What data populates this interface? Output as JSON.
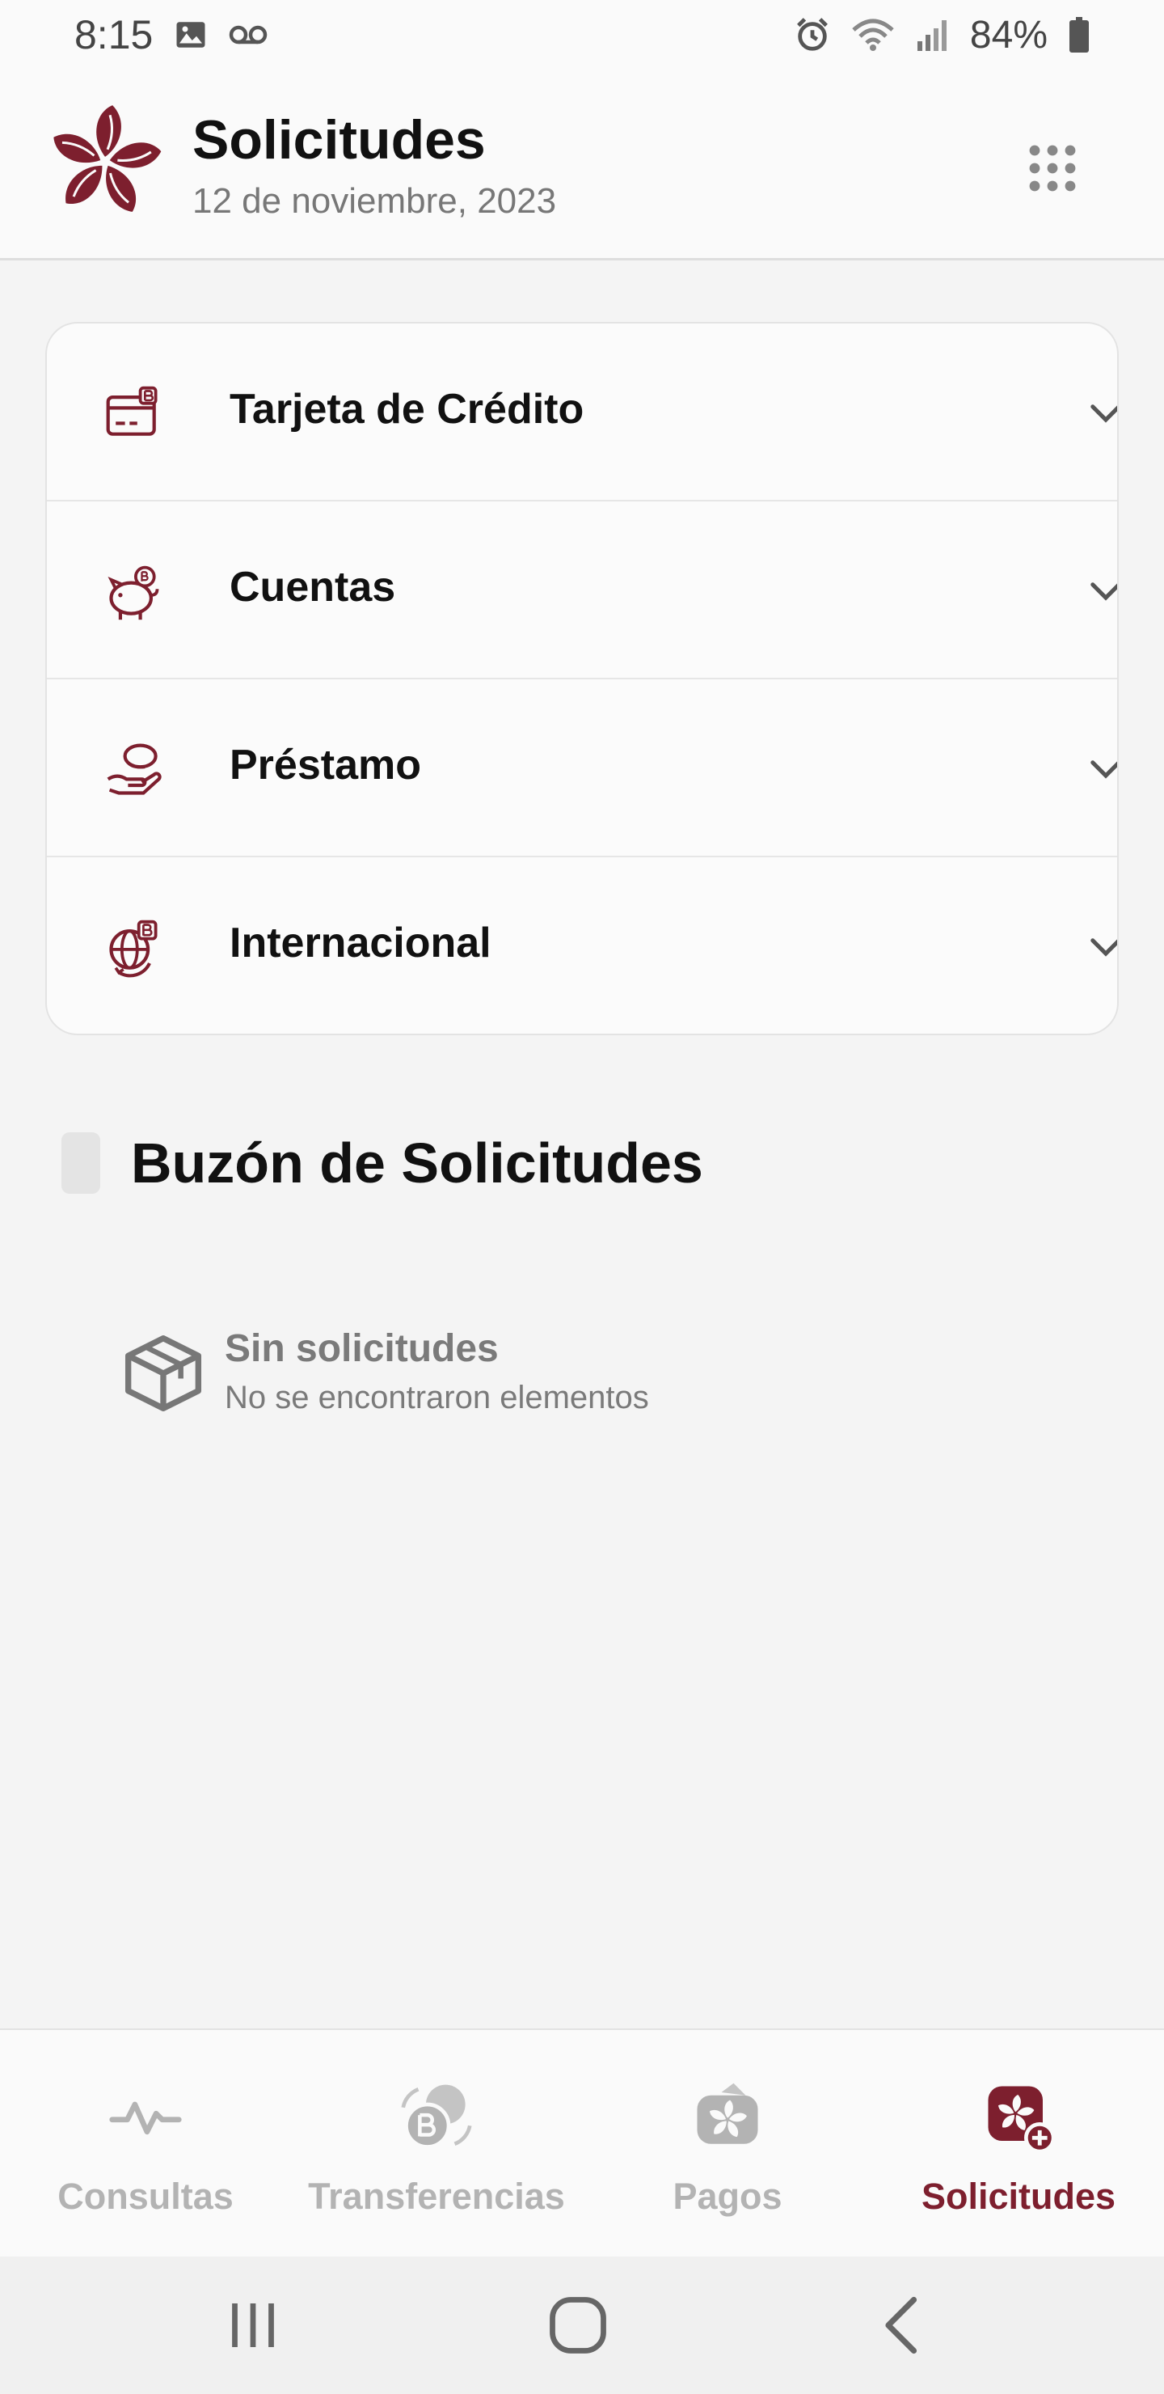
{
  "status_bar": {
    "time": "8:15",
    "battery": "84%",
    "icons": [
      "image-icon",
      "voicemail-icon",
      "alarm-icon",
      "wifi-icon",
      "signal-icon",
      "battery-icon"
    ]
  },
  "header": {
    "title": "Solicitudes",
    "date": "12 de noviembre, 2023"
  },
  "colors": {
    "brand": "#7d1f2e",
    "inactive": "#b3b3b3"
  },
  "requests": [
    {
      "label": "Tarjeta de Crédito",
      "icon": "credit-card-icon"
    },
    {
      "label": "Cuentas",
      "icon": "piggy-bank-icon"
    },
    {
      "label": "Préstamo",
      "icon": "hand-coin-icon"
    },
    {
      "label": "Internacional",
      "icon": "globe-icon"
    }
  ],
  "inbox": {
    "title": "Buzón de Solicitudes",
    "empty_title": "Sin solicitudes",
    "empty_subtitle": "No se encontraron elementos"
  },
  "bottom_nav": {
    "items": [
      {
        "label": "Consultas",
        "icon": "activity-icon",
        "active": false
      },
      {
        "label": "Transferencias",
        "icon": "transfer-icon",
        "active": false
      },
      {
        "label": "Pagos",
        "icon": "payments-icon",
        "active": false
      },
      {
        "label": "Solicitudes",
        "icon": "requests-icon",
        "active": true
      }
    ]
  }
}
